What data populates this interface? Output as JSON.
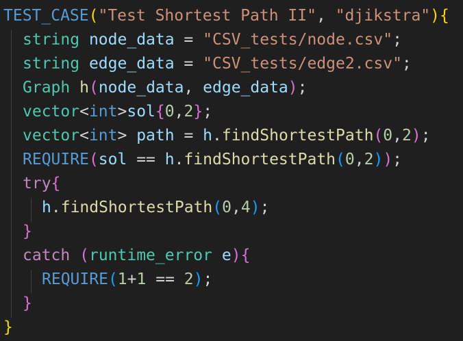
{
  "editor": {
    "colors": {
      "background": "#1f1f1f",
      "guide": "#404040",
      "plain": "#d4d4d4",
      "macro": "#569cd6",
      "string": "#ce9178",
      "type": "#4ec9b0",
      "variable": "#9cdcfe",
      "function": "#dcdcaa",
      "keyword": "#c586c0",
      "number": "#b5cea8",
      "bracket_gold": "#ffd700",
      "bracket_pink": "#da70d6",
      "bracket_blue": "#179fff"
    },
    "lines": [
      {
        "indent": 0,
        "tokens": [
          {
            "t": "TEST_CASE",
            "c": "macro"
          },
          {
            "t": "(",
            "c": "bracket_gold"
          },
          {
            "t": "\"Test Shortest Path II\"",
            "c": "string"
          },
          {
            "t": ", ",
            "c": "plain"
          },
          {
            "t": "\"djikstra\"",
            "c": "string"
          },
          {
            "t": ")",
            "c": "bracket_gold"
          },
          {
            "t": "{",
            "c": "bracket_gold"
          }
        ]
      },
      {
        "indent": 1,
        "tokens": [
          {
            "t": "string",
            "c": "type"
          },
          {
            "t": " ",
            "c": "plain"
          },
          {
            "t": "node_data",
            "c": "variable"
          },
          {
            "t": " = ",
            "c": "plain"
          },
          {
            "t": "\"CSV_tests/node.csv\"",
            "c": "string"
          },
          {
            "t": ";",
            "c": "plain"
          }
        ]
      },
      {
        "indent": 1,
        "tokens": [
          {
            "t": "string",
            "c": "type"
          },
          {
            "t": " ",
            "c": "plain"
          },
          {
            "t": "edge_data",
            "c": "variable"
          },
          {
            "t": " = ",
            "c": "plain"
          },
          {
            "t": "\"CSV_tests/edge2.csv\"",
            "c": "string"
          },
          {
            "t": ";",
            "c": "plain"
          }
        ]
      },
      {
        "indent": 1,
        "tokens": [
          {
            "t": "Graph",
            "c": "type"
          },
          {
            "t": " ",
            "c": "plain"
          },
          {
            "t": "h",
            "c": "function"
          },
          {
            "t": "(",
            "c": "bracket_pink"
          },
          {
            "t": "node_data",
            "c": "variable"
          },
          {
            "t": ", ",
            "c": "plain"
          },
          {
            "t": "edge_data",
            "c": "variable"
          },
          {
            "t": ")",
            "c": "bracket_pink"
          },
          {
            "t": ";",
            "c": "plain"
          }
        ]
      },
      {
        "indent": 1,
        "tokens": [
          {
            "t": "vector",
            "c": "type"
          },
          {
            "t": "<",
            "c": "plain"
          },
          {
            "t": "int",
            "c": "macro"
          },
          {
            "t": ">",
            "c": "plain"
          },
          {
            "t": "sol",
            "c": "variable"
          },
          {
            "t": "{",
            "c": "bracket_pink"
          },
          {
            "t": "0",
            "c": "number"
          },
          {
            "t": ",",
            "c": "plain"
          },
          {
            "t": "2",
            "c": "number"
          },
          {
            "t": "}",
            "c": "bracket_pink"
          },
          {
            "t": ";",
            "c": "plain"
          }
        ]
      },
      {
        "indent": 1,
        "tokens": [
          {
            "t": "vector",
            "c": "type"
          },
          {
            "t": "<",
            "c": "plain"
          },
          {
            "t": "int",
            "c": "macro"
          },
          {
            "t": "> ",
            "c": "plain"
          },
          {
            "t": "path",
            "c": "variable"
          },
          {
            "t": " = ",
            "c": "plain"
          },
          {
            "t": "h",
            "c": "variable"
          },
          {
            "t": ".",
            "c": "plain"
          },
          {
            "t": "findShortestPath",
            "c": "function"
          },
          {
            "t": "(",
            "c": "bracket_pink"
          },
          {
            "t": "0",
            "c": "number"
          },
          {
            "t": ",",
            "c": "plain"
          },
          {
            "t": "2",
            "c": "number"
          },
          {
            "t": ")",
            "c": "bracket_pink"
          },
          {
            "t": ";",
            "c": "plain"
          }
        ]
      },
      {
        "indent": 1,
        "tokens": [
          {
            "t": "REQUIRE",
            "c": "macro"
          },
          {
            "t": "(",
            "c": "bracket_pink"
          },
          {
            "t": "sol",
            "c": "variable"
          },
          {
            "t": " == ",
            "c": "plain"
          },
          {
            "t": "h",
            "c": "variable"
          },
          {
            "t": ".",
            "c": "plain"
          },
          {
            "t": "findShortestPath",
            "c": "function"
          },
          {
            "t": "(",
            "c": "bracket_blue"
          },
          {
            "t": "0",
            "c": "number"
          },
          {
            "t": ",",
            "c": "plain"
          },
          {
            "t": "2",
            "c": "number"
          },
          {
            "t": ")",
            "c": "bracket_blue"
          },
          {
            "t": ")",
            "c": "bracket_pink"
          },
          {
            "t": ";",
            "c": "plain"
          }
        ]
      },
      {
        "indent": 1,
        "tokens": [
          {
            "t": "try",
            "c": "keyword"
          },
          {
            "t": "{",
            "c": "bracket_pink"
          }
        ]
      },
      {
        "indent": 2,
        "tokens": [
          {
            "t": "h",
            "c": "variable"
          },
          {
            "t": ".",
            "c": "plain"
          },
          {
            "t": "findShortestPath",
            "c": "function"
          },
          {
            "t": "(",
            "c": "bracket_blue"
          },
          {
            "t": "0",
            "c": "number"
          },
          {
            "t": ",",
            "c": "plain"
          },
          {
            "t": "4",
            "c": "number"
          },
          {
            "t": ")",
            "c": "bracket_blue"
          },
          {
            "t": ";",
            "c": "plain"
          }
        ]
      },
      {
        "indent": 1,
        "tokens": [
          {
            "t": "}",
            "c": "bracket_pink"
          }
        ]
      },
      {
        "indent": 1,
        "tokens": [
          {
            "t": "catch",
            "c": "keyword"
          },
          {
            "t": " ",
            "c": "plain"
          },
          {
            "t": "(",
            "c": "bracket_pink"
          },
          {
            "t": "runtime_error",
            "c": "type"
          },
          {
            "t": " ",
            "c": "plain"
          },
          {
            "t": "e",
            "c": "variable"
          },
          {
            "t": ")",
            "c": "bracket_pink"
          },
          {
            "t": "{",
            "c": "bracket_pink"
          }
        ]
      },
      {
        "indent": 2,
        "tokens": [
          {
            "t": "REQUIRE",
            "c": "macro"
          },
          {
            "t": "(",
            "c": "bracket_blue"
          },
          {
            "t": "1",
            "c": "number"
          },
          {
            "t": "+",
            "c": "plain"
          },
          {
            "t": "1",
            "c": "number"
          },
          {
            "t": " == ",
            "c": "plain"
          },
          {
            "t": "2",
            "c": "number"
          },
          {
            "t": ")",
            "c": "bracket_blue"
          },
          {
            "t": ";",
            "c": "plain"
          }
        ]
      },
      {
        "indent": 1,
        "tokens": [
          {
            "t": "}",
            "c": "bracket_pink"
          }
        ]
      },
      {
        "indent": 0,
        "tokens": [
          {
            "t": "}",
            "c": "bracket_gold"
          }
        ]
      }
    ]
  }
}
